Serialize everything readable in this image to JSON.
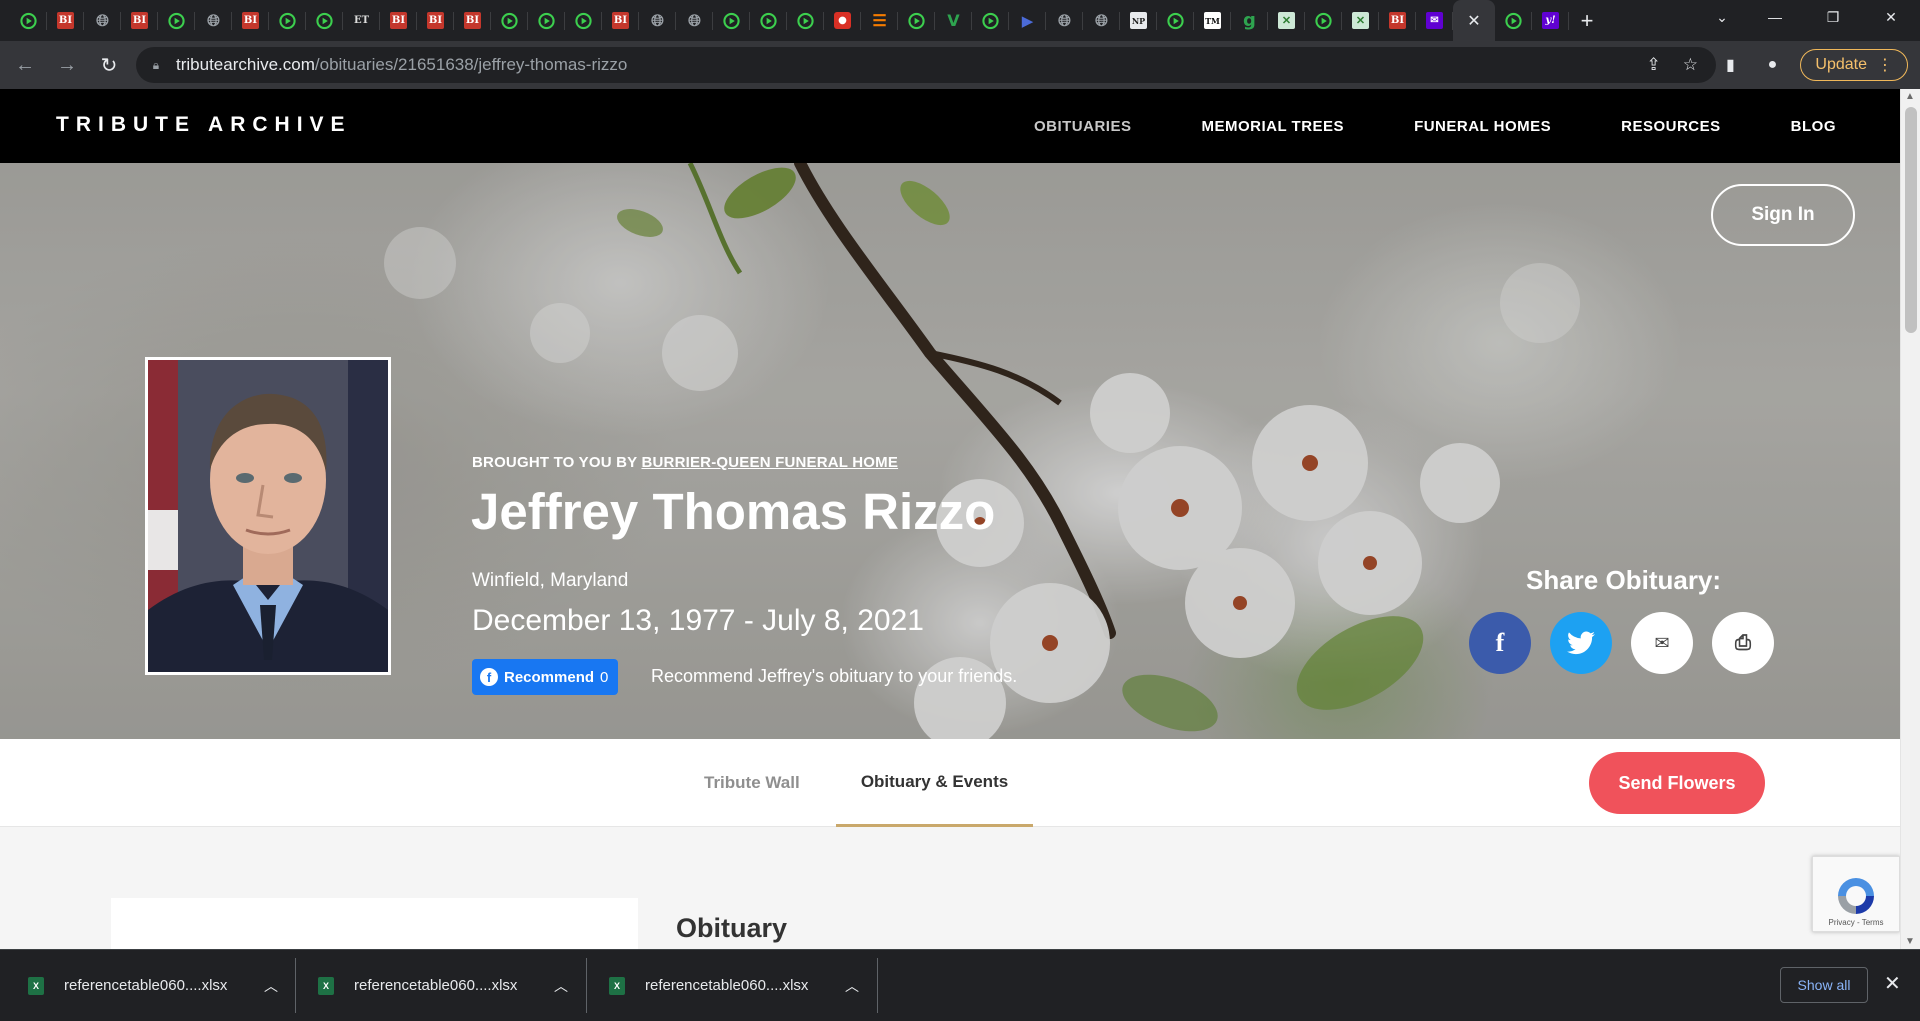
{
  "browser": {
    "tabs": [
      {
        "icon": "play-icon"
      },
      {
        "icon": "bi-icon",
        "text": "BI"
      },
      {
        "icon": "globe-icon"
      },
      {
        "icon": "bi-icon",
        "text": "BI"
      },
      {
        "icon": "play-icon"
      },
      {
        "icon": "globe-icon"
      },
      {
        "icon": "bi-icon",
        "text": "BI"
      },
      {
        "icon": "play-icon"
      },
      {
        "icon": "play-icon"
      },
      {
        "icon": "et-icon",
        "text": "ET"
      },
      {
        "icon": "bi-icon",
        "text": "BI"
      },
      {
        "icon": "bi-icon",
        "text": "BI"
      },
      {
        "icon": "bi-icon",
        "text": "BI"
      },
      {
        "icon": "play-icon"
      },
      {
        "icon": "play-icon"
      },
      {
        "icon": "play-icon"
      },
      {
        "icon": "bi-icon",
        "text": "BI"
      },
      {
        "icon": "globe-icon"
      },
      {
        "icon": "globe-icon"
      },
      {
        "icon": "play-icon"
      },
      {
        "icon": "play-icon"
      },
      {
        "icon": "play-icon"
      },
      {
        "icon": "red-icon"
      },
      {
        "icon": "orange-bars-icon"
      },
      {
        "icon": "play-icon"
      },
      {
        "icon": "v-icon",
        "text": "V"
      },
      {
        "icon": "play-icon"
      },
      {
        "icon": "d-icon"
      },
      {
        "icon": "globe-icon"
      },
      {
        "icon": "globe-icon"
      },
      {
        "icon": "np-icon",
        "text": "NP"
      },
      {
        "icon": "play-icon"
      },
      {
        "icon": "tm-icon",
        "text": "TM"
      },
      {
        "icon": "g-icon",
        "text": "g"
      },
      {
        "icon": "x-icon",
        "text": "✕"
      },
      {
        "icon": "play-icon"
      },
      {
        "icon": "x-icon",
        "text": "✕"
      },
      {
        "icon": "bi-icon",
        "text": "BI"
      },
      {
        "icon": "mail-icon",
        "text": "✉"
      }
    ],
    "trailing_tabs": [
      {
        "icon": "play-icon"
      },
      {
        "icon": "y-icon",
        "text": "y!"
      }
    ],
    "url_host": "tributearchive.com",
    "url_path": "/obituaries/21651638/jeffrey-thomas-rizzo",
    "update_label": "Update"
  },
  "site": {
    "brand": "TRIBUTE ARCHIVE",
    "nav": [
      "OBITUARIES",
      "MEMORIAL TREES",
      "FUNERAL HOMES",
      "RESOURCES",
      "BLOG"
    ],
    "signin_label": "Sign In"
  },
  "obituary": {
    "brought_prefix": "BROUGHT TO YOU BY",
    "funeral_home": "BURRIER-QUEEN FUNERAL HOME",
    "name": "Jeffrey Thomas Rizzo",
    "location": "Winfield, Maryland",
    "dates": "December 13, 1977 - July 8, 2021",
    "recommend_label": "Recommend",
    "recommend_count": "0",
    "recommend_text": "Recommend Jeffrey's obituary to your friends.",
    "share_title": "Share Obituary:",
    "share_buttons": [
      "facebook-icon",
      "twitter-icon",
      "email-icon",
      "print-icon"
    ]
  },
  "page_tabs": {
    "tribute_wall": "Tribute Wall",
    "obituary_events": "Obituary & Events",
    "send_flowers": "Send Flowers"
  },
  "content": {
    "heading": "Obituary",
    "recaptcha_text": "Privacy - Terms"
  },
  "downloads": {
    "items": [
      "referencetable060....xlsx",
      "referencetable060....xlsx",
      "referencetable060....xlsx"
    ],
    "show_all": "Show all"
  }
}
